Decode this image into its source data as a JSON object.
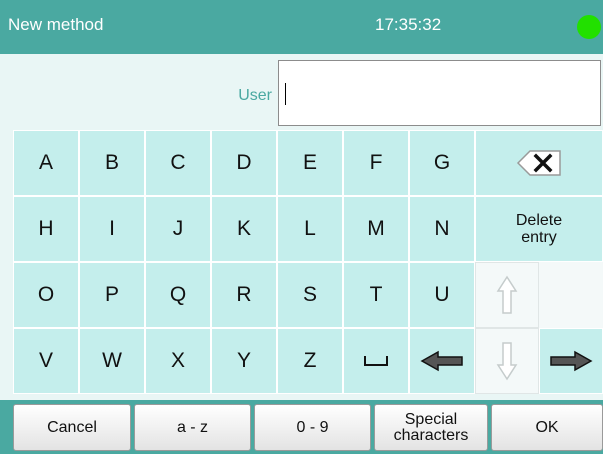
{
  "header": {
    "title": "New method",
    "time": "17:35:32",
    "status_color": "#22e000"
  },
  "input": {
    "label": "User",
    "value": ""
  },
  "keys": {
    "row1": [
      "A",
      "B",
      "C",
      "D",
      "E",
      "F",
      "G"
    ],
    "row2": [
      "H",
      "I",
      "J",
      "K",
      "L",
      "M",
      "N"
    ],
    "row3": [
      "O",
      "P",
      "Q",
      "R",
      "S",
      "T",
      "U"
    ],
    "row4": [
      "V",
      "W",
      "X",
      "Y",
      "Z"
    ],
    "space_glyph": "␣",
    "delete_entry": "Delete entry"
  },
  "icons": {
    "backspace": "backspace-icon",
    "left": "arrow-left-icon",
    "right": "arrow-right-icon",
    "up": "arrow-up-icon",
    "down": "arrow-down-icon"
  },
  "bottom": {
    "cancel": "Cancel",
    "az": "a - z",
    "digits": "0 - 9",
    "special": "Special characters",
    "ok": "OK"
  },
  "colors": {
    "header": "#4aa9a1",
    "key": "#c4eeec",
    "background": "#e9f6f5"
  }
}
